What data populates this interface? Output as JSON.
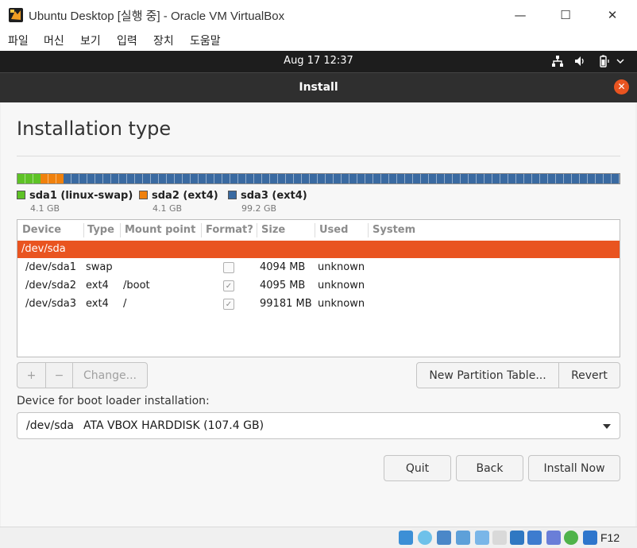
{
  "window": {
    "title": "Ubuntu Desktop [실행 중] - Oracle VM VirtualBox",
    "minimize": "—",
    "maximize": "☐",
    "close": "✕"
  },
  "menu": [
    "파일",
    "머신",
    "보기",
    "입력",
    "장치",
    "도움말"
  ],
  "topbar": {
    "clock": "Aug 17  12:37",
    "network_icon": "network-icon",
    "volume_icon": "volume-icon",
    "battery_icon": "battery-icon"
  },
  "dialog": {
    "title": "Install",
    "close_icon": "✕"
  },
  "page": {
    "title": "Installation type"
  },
  "partitions": {
    "bar": [
      {
        "name": "sda1 (linux-swap)",
        "size": "4.1 GB",
        "color": "#5ec226",
        "fraction": 0.038
      },
      {
        "name": "sda2 (ext4)",
        "size": "4.1 GB",
        "color": "#f0810d",
        "fraction": 0.038
      },
      {
        "name": "sda3 (ext4)",
        "size": "99.2 GB",
        "color": "#3a6aa1",
        "fraction": 0.924
      }
    ]
  },
  "table": {
    "headers": [
      "Device",
      "Type",
      "Mount point",
      "Format?",
      "Size",
      "Used",
      "System"
    ],
    "selected": "/dev/sda",
    "rows": [
      {
        "device": "/dev/sda1",
        "type": "swap",
        "mount": "",
        "format": false,
        "size": "4094 MB",
        "used": "unknown"
      },
      {
        "device": "/dev/sda2",
        "type": "ext4",
        "mount": "/boot",
        "format": true,
        "size": "4095 MB",
        "used": "unknown"
      },
      {
        "device": "/dev/sda3",
        "type": "ext4",
        "mount": "/",
        "format": true,
        "size": "99181 MB",
        "used": "unknown"
      }
    ]
  },
  "buttons": {
    "add": "+",
    "remove": "−",
    "change": "Change...",
    "new_table": "New Partition Table...",
    "revert": "Revert",
    "quit": "Quit",
    "back": "Back",
    "install": "Install Now"
  },
  "boot": {
    "label": "Device for boot loader installation:",
    "device": "/dev/sda",
    "desc": "ATA VBOX HARDDISK (107.4 GB)"
  },
  "statusbar": {
    "hostkey": "F12"
  }
}
